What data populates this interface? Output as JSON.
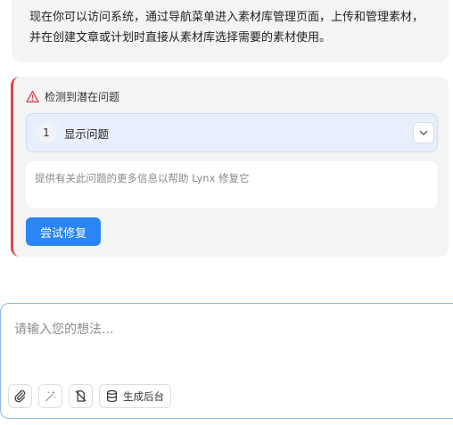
{
  "message": {
    "text": "现在你可以访问系统，通过导航菜单进入素材库管理页面，上传和管理素材，并在创建文章或计划时直接从素材库选择需要的素材使用。"
  },
  "issue": {
    "header_label": "检测到潜在问题",
    "index": "1",
    "selected_label": "显示问题",
    "textarea_placeholder": "提供有关此问题的更多信息以帮助 Lynx 修复它",
    "fix_button_label": "尝试修复",
    "accent_color": "#e04646"
  },
  "chat": {
    "placeholder": "请输入您的想法...",
    "tools": [
      {
        "icon": "paperclip-icon"
      },
      {
        "icon": "magic-wand-icon"
      },
      {
        "icon": "disabled-file-icon"
      },
      {
        "icon": "database-icon",
        "label": "生成后台"
      }
    ]
  },
  "colors": {
    "primary": "#2c85f4",
    "card_bg": "#f4f4f5",
    "select_bg": "#e8effc"
  }
}
